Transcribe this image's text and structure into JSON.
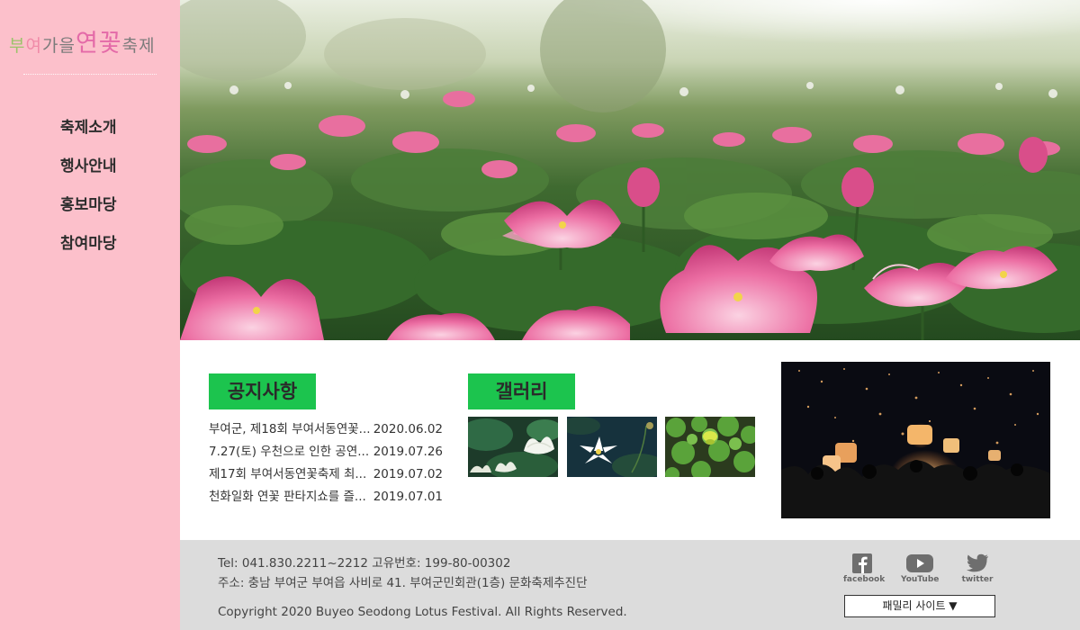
{
  "logo": {
    "part1": "부",
    "part2": "여",
    "part3": "가을",
    "part4": "연꽃",
    "part5": "축제"
  },
  "nav": {
    "items": [
      {
        "label": "축제소개"
      },
      {
        "label": "행사안내"
      },
      {
        "label": "홍보마당"
      },
      {
        "label": "참여마당"
      }
    ]
  },
  "notice": {
    "title": "공지사항",
    "items": [
      {
        "title": "부여군, 제18회 부여서동연꽃...",
        "date": "2020.06.02"
      },
      {
        "title": "7.27(토) 우천으로 인한 공연...",
        "date": "2019.07.26"
      },
      {
        "title": "제17회 부여서동연꽃축제 최...",
        "date": "2019.07.02"
      },
      {
        "title": "천화일화 연꽃 판타지쇼를 즐...",
        "date": "2019.07.01"
      }
    ]
  },
  "gallery": {
    "title": "갤러리"
  },
  "footer": {
    "tel": "Tel: 041.830.2211~2212 고유번호: 199-80-00302",
    "address": "주소: 충남 부여군 부여읍 사비로 41. 부여군민회관(1층) 문화축제추진단",
    "copyright": "Copyright 2020 Buyeo Seodong Lotus Festival. All Rights Reserved.",
    "social": {
      "facebook": "facebook",
      "youtube": "YouTube",
      "twitter": "twitter"
    },
    "family_site": "패밀리 사이트 ▼"
  },
  "colors": {
    "sidebar_bg": "#fcc0cb",
    "section_title_bg": "#1cc44e",
    "footer_bg": "#dcdcdc"
  },
  "icons": [
    "facebook-icon",
    "youtube-icon",
    "twitter-icon"
  ]
}
